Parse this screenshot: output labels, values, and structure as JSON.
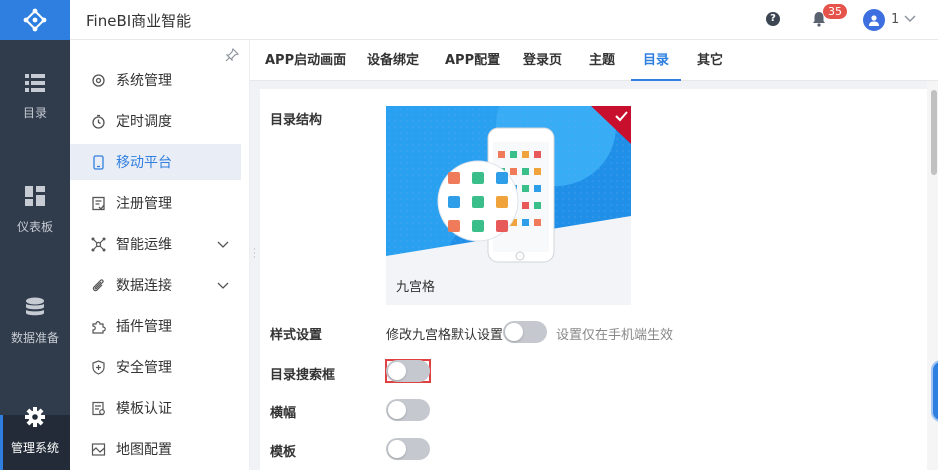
{
  "header": {
    "app_title": "FineBI商业智能",
    "notification_count": "35",
    "user_name": "1"
  },
  "leftnav": [
    {
      "label": "目录",
      "icon": "list-icon"
    },
    {
      "label": "仪表板",
      "icon": "dashboard-icon"
    },
    {
      "label": "数据准备",
      "icon": "database-icon"
    },
    {
      "label": "管理系统",
      "icon": "gear-icon",
      "active": true
    }
  ],
  "submenu": [
    {
      "label": "系统管理"
    },
    {
      "label": "定时调度"
    },
    {
      "label": "移动平台",
      "active": true
    },
    {
      "label": "注册管理"
    },
    {
      "label": "智能运维",
      "expandable": true
    },
    {
      "label": "数据连接",
      "expandable": true
    },
    {
      "label": "插件管理"
    },
    {
      "label": "安全管理"
    },
    {
      "label": "模板认证"
    },
    {
      "label": "地图配置"
    }
  ],
  "tabs": [
    "APP启动画面",
    "设备绑定",
    "APP配置",
    "登录页",
    "主题",
    "目录",
    "其它"
  ],
  "active_tab": "目录",
  "settings": {
    "catalog_structure_label": "目录结构",
    "preview_caption": "九宫格",
    "style_setting_label": "样式设置",
    "style_setting_option": "修改九宫格默认设置",
    "style_setting_hint": "设置仅在手机端生效",
    "search_box_label": "目录搜索框",
    "banner_label": "横幅",
    "template_label": "模板"
  },
  "toggles": {
    "style_setting": false,
    "search_box": false,
    "banner": false,
    "template": false
  },
  "colors": {
    "accent": "#2f7fe0",
    "nav_bg": "#303b4b",
    "badge": "#e5534b",
    "selected_corner": "#c8102e"
  }
}
